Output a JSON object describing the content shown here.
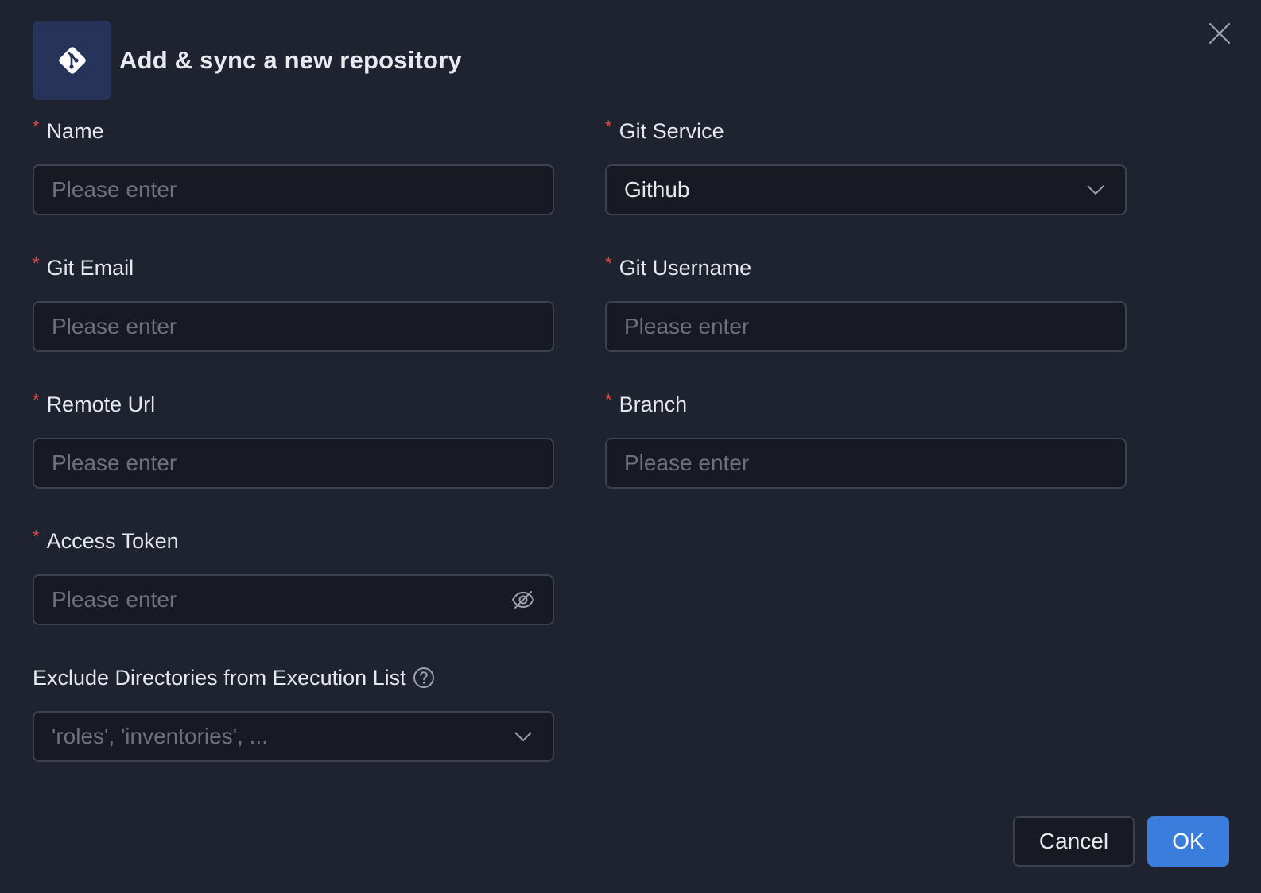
{
  "dialog": {
    "title": "Add & sync a new repository",
    "icon": "git-icon",
    "accent_color": "#3b7ddd",
    "required_color": "#e5484d"
  },
  "fields": {
    "name": {
      "label": "Name",
      "required_mark": "*",
      "placeholder": "Please enter"
    },
    "git_service": {
      "label": "Git Service",
      "required_mark": "*",
      "value": "Github"
    },
    "git_email": {
      "label": "Git Email",
      "required_mark": "*",
      "placeholder": "Please enter"
    },
    "git_username": {
      "label": "Git Username",
      "required_mark": "*",
      "placeholder": "Please enter"
    },
    "remote_url": {
      "label": "Remote Url",
      "required_mark": "*",
      "placeholder": "Please enter"
    },
    "branch": {
      "label": "Branch",
      "required_mark": "*",
      "placeholder": "Please enter"
    },
    "access_token": {
      "label": "Access Token",
      "required_mark": "*",
      "placeholder": "Please enter"
    },
    "exclude_dirs": {
      "label": "Exclude Directories from Execution List",
      "placeholder": "'roles', 'inventories', ..."
    }
  },
  "footer": {
    "cancel_label": "Cancel",
    "ok_label": "OK"
  }
}
